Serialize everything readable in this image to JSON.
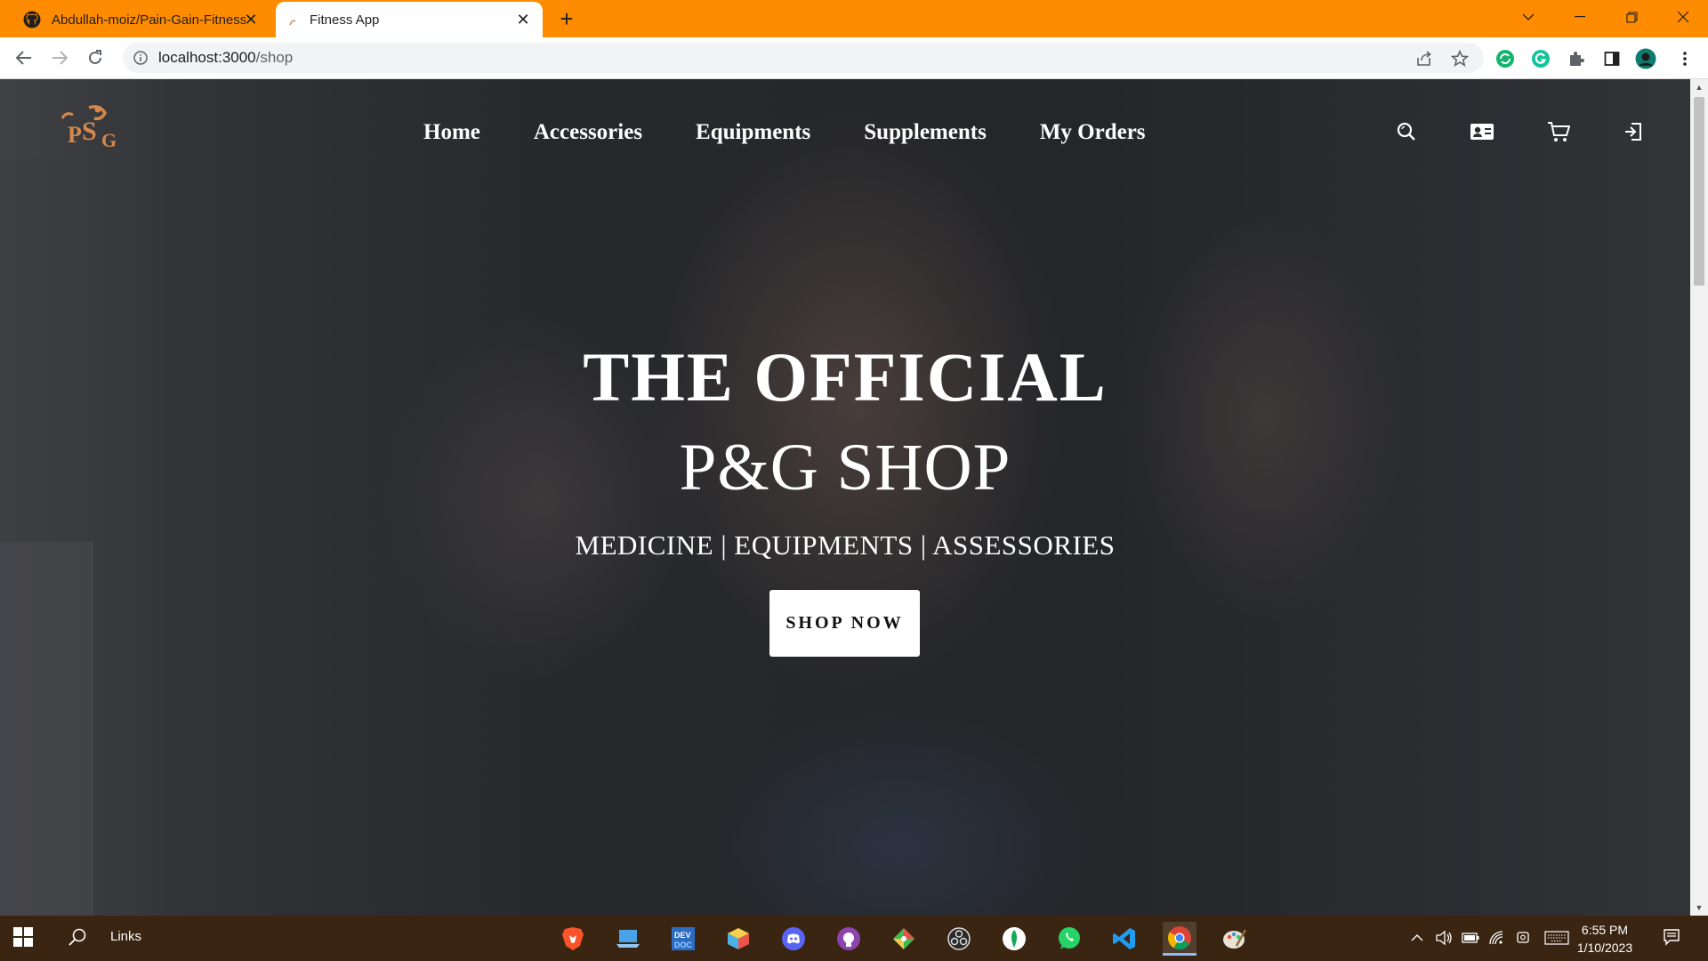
{
  "browser": {
    "tabs": [
      {
        "title": "Abdullah-moiz/Pain-Gain-Fitness",
        "icon": "github-icon"
      },
      {
        "title": "Fitness App",
        "icon": "app-favicon"
      }
    ],
    "url_host": "localhost:3000",
    "url_path": "/shop",
    "accent_color": "#ff8c00"
  },
  "site": {
    "logo_text": "P&G",
    "nav": [
      {
        "label": "Home"
      },
      {
        "label": "Accessories"
      },
      {
        "label": "Equipments"
      },
      {
        "label": "Supplements"
      },
      {
        "label": "My Orders"
      }
    ],
    "header_icons": [
      "search-icon",
      "contact-card-icon",
      "cart-icon",
      "logout-icon"
    ]
  },
  "hero": {
    "line1": "THE OFFICIAL",
    "line2": "P&G SHOP",
    "subtitle": "MEDICINE | EQUIPMENTS | ASSESSORIES",
    "cta": "SHOP NOW"
  },
  "taskbar": {
    "search_label": "Links",
    "apps": [
      "brave-icon",
      "laptop-icon",
      "devdocs-icon",
      "3d-box-icon",
      "discord-icon",
      "github-desktop-icon",
      "git-kraken-icon",
      "obs-icon",
      "mongodb-icon",
      "whatsapp-icon",
      "vscode-icon",
      "chrome-icon",
      "paint-icon"
    ],
    "time": "6:55 PM",
    "date": "1/10/2023"
  }
}
